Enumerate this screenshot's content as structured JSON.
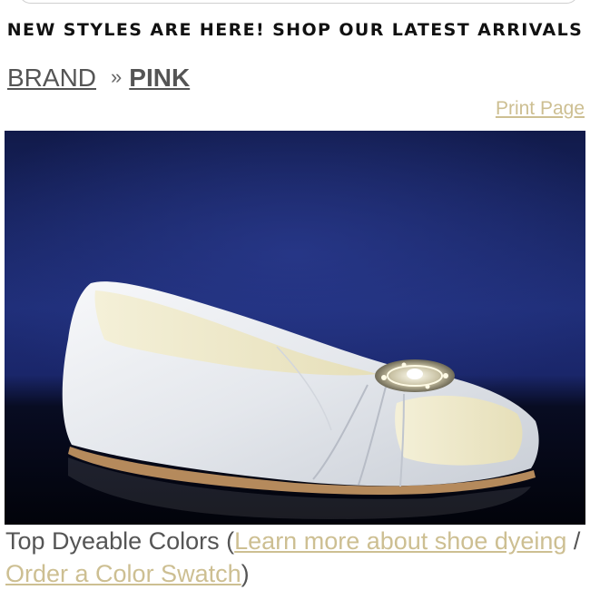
{
  "promo_banner": {
    "text": "NEW STYLES ARE HERE! SHOP OUR LATEST ARRIVALS"
  },
  "breadcrumb": {
    "items": [
      {
        "label": "BRAND"
      },
      {
        "separator": "»"
      },
      {
        "label": "PINK",
        "current": true
      }
    ]
  },
  "print_link": {
    "label": "Print Page"
  },
  "product_image": {
    "subject": "white satin peep-toe ballet flat with jeweled brooch",
    "background": "#1c2a6e"
  },
  "colors_section": {
    "heading": "Top Dyeable Colors",
    "open_paren": "(",
    "learn_link": "Learn more about shoe dyeing",
    "divider": " / ",
    "swatch_link": "Order a Color Swatch",
    "close_paren": ")"
  },
  "theme": {
    "link_color": "#cdbf92",
    "text_color": "#555555",
    "promo_color": "#111111"
  }
}
